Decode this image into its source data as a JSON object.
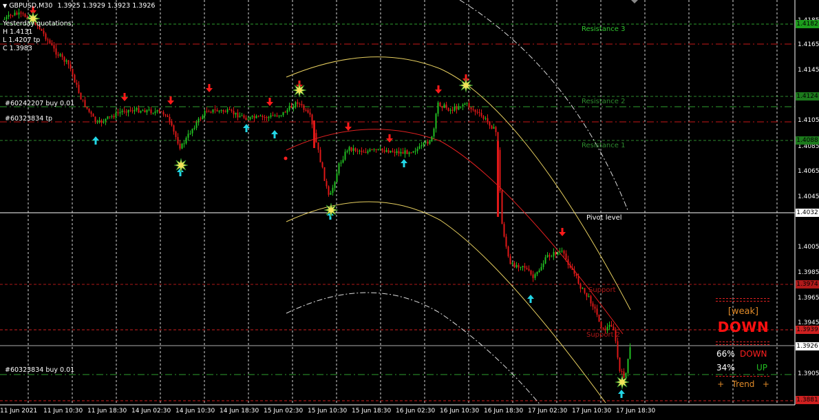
{
  "header": {
    "symbol_label": "GBPUSD,M30",
    "ohlc": "1.3925 1.3929 1.3923 1.3926",
    "yesterday_title": "Yesterday quotations:",
    "yesterday_high": "H 1.4131",
    "yesterday_low": "L 1.4207 tp",
    "yesterday_close": "C 1.3983"
  },
  "orders": {
    "buy_1": "#60242207 buy 0.01",
    "tp_1": "#60323834 tp",
    "buy_2": "#60323834 buy 0.01"
  },
  "levels": {
    "resistance_3": "Resistance 3",
    "resistance_2": "Resistance 2",
    "resistance_1": "Resistance 1",
    "pivot": "Pivot level",
    "support_1": "Support",
    "support_2": "Support 2"
  },
  "price_axis": {
    "ticks": [
      "1.4185",
      "1.4165",
      "1.4145",
      "1.4124",
      "1.4105",
      "1.4085",
      "1.4065",
      "1.4045",
      "1.4025",
      "1.4005",
      "1.3985",
      "1.3965",
      "1.3945",
      "1.3925",
      "1.3905",
      "1.3885"
    ],
    "tags": {
      "resistance_3": "1.4182",
      "resistance_2": "1.4124",
      "resistance_1": "1.4088",
      "pivot": "1.4032",
      "support_1": "1.3974",
      "support_2": "1.3939",
      "current": "1.3926",
      "bottom": "1.3881"
    }
  },
  "time_axis": {
    "ticks": [
      "11 Jun 2021",
      "11 Jun 10:30",
      "11 Jun 18:30",
      "14 Jun 02:30",
      "14 Jun 10:30",
      "14 Jun 18:30",
      "15 Jun 02:30",
      "15 Jun 10:30",
      "15 Jun 18:30",
      "16 Jun 02:30",
      "16 Jun 10:30",
      "16 Jun 18:30",
      "17 Jun 02:30",
      "17 Jun 10:30",
      "17 Jun 18:30"
    ]
  },
  "trend_panel": {
    "strength": "[weak]",
    "direction": "DOWN",
    "down_pct": "66%",
    "down_label": "DOWN",
    "up_pct": "34%",
    "up_label": "UP",
    "trend_label": "+   Trend   +"
  },
  "colors": {
    "background": "#000000",
    "bull_candle": "#22c022",
    "bear_candle": "#e01818",
    "resistance_line": "#2e9a2e",
    "support_line": "#c01818",
    "pivot_line": "#ffffff",
    "arrow_down": "#ff1a1a",
    "arrow_up": "#22d6e6",
    "channel": "#e8d060",
    "regression": "#e02020"
  }
}
